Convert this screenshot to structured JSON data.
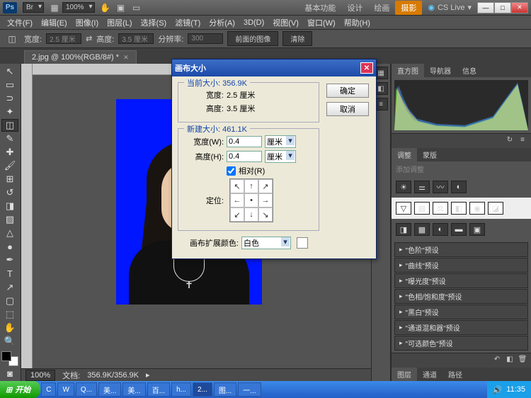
{
  "titlebar": {
    "logo": "Ps",
    "zoom_dd": "100%",
    "ws": [
      "基本功能",
      "设计",
      "绘画",
      "摄影"
    ],
    "ws_active": 3,
    "cslive": "CS Live"
  },
  "menu": [
    "文件(F)",
    "编辑(E)",
    "图像(I)",
    "图层(L)",
    "选择(S)",
    "滤镜(T)",
    "分析(A)",
    "3D(D)",
    "视图(V)",
    "窗口(W)",
    "帮助(H)"
  ],
  "optbar": {
    "crop_icon": "✂",
    "width_lbl": "宽度:",
    "width_v": "2.5 厘米",
    "height_lbl": "高度:",
    "height_v": "3.5 厘米",
    "res_lbl": "分辨率:",
    "res_v": "300",
    "front_lbl": "前面的图像",
    "clear_lbl": "清除"
  },
  "doctab": {
    "name": "2.jpg @ 100%(RGB/8#) *"
  },
  "status": {
    "zoom": "100%",
    "docsize_lbl": "文档:",
    "docsize": "356.9K/356.9K"
  },
  "dialog": {
    "title": "画布大小",
    "ok": "确定",
    "cancel": "取消",
    "current_lbl": "当前大小: 356.9K",
    "cur_w_lbl": "宽度:",
    "cur_w": "2.5 厘米",
    "cur_h_lbl": "高度:",
    "cur_h": "3.5 厘米",
    "new_lbl": "新建大小: 461.1K",
    "new_w_lbl": "宽度(W):",
    "new_w": "0.4",
    "new_w_unit": "厘米",
    "new_h_lbl": "高度(H):",
    "new_h": "0.4",
    "new_h_unit": "厘米",
    "relative_lbl": "相对(R)",
    "anchor_lbl": "定位:",
    "ext_lbl": "画布扩展颜色:",
    "ext_val": "白色"
  },
  "rpanel": {
    "hist_tabs": [
      "直方图",
      "导航器",
      "信息"
    ],
    "adj_tabs": [
      "调整",
      "蒙版"
    ],
    "add_adj": "添加调整",
    "presets": [
      "\"色阶\"预设",
      "\"曲线\"预设",
      "\"曝光度\"预设",
      "\"色相/饱和度\"预设",
      "\"黑白\"预设",
      "\"通道混和器\"预设",
      "\"可选颜色\"预设"
    ],
    "layer_tabs": [
      "图层",
      "通道",
      "路径"
    ]
  },
  "taskbar": {
    "start": "开始",
    "items": [
      "C",
      "W",
      "Q...",
      "美...",
      "美...",
      "百...",
      "h...",
      "2...",
      "图...",
      "一..."
    ],
    "active": 7,
    "time": "11:35"
  }
}
